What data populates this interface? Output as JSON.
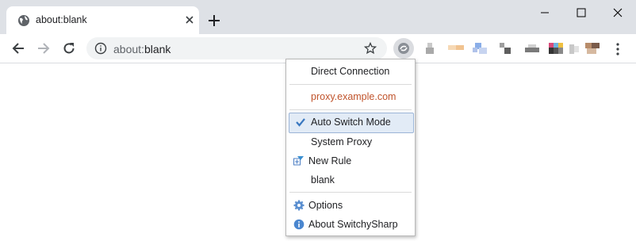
{
  "tab": {
    "title": "about:blank"
  },
  "omnibox": {
    "url_prefix": "about:",
    "url_rest": "blank"
  },
  "popup": {
    "items": [
      {
        "label": "Direct Connection"
      },
      {
        "label": "proxy.example.com"
      },
      {
        "label": "Auto Switch Mode",
        "selected": true
      },
      {
        "label": "System Proxy"
      },
      {
        "label": "New Rule"
      },
      {
        "label": "blank"
      },
      {
        "label": "Options"
      },
      {
        "label": "About SwitchySharp"
      }
    ]
  },
  "colors": {
    "proxy_text": "#c0532b",
    "selected_bg": "#e2ebf6",
    "tabstrip": "#dee1e6"
  }
}
